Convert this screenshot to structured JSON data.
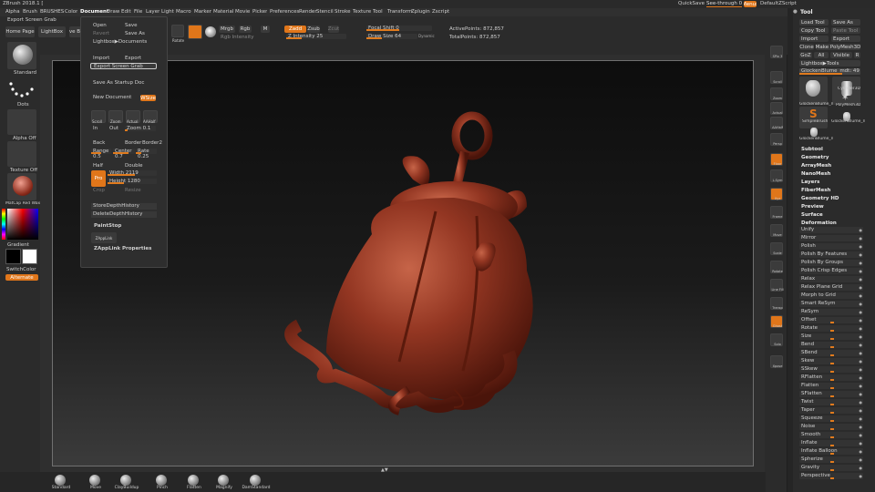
{
  "app": {
    "title": "ZBrush 2018.1 [",
    "quicksave": "QuickSave",
    "seethrough": "See-through 0",
    "menus_btn": "Menus",
    "default_script": "DefaultZScript"
  },
  "menubar": [
    "Alpha",
    "Brush",
    "BRUSHES",
    "Color",
    "Document",
    "Draw",
    "Edit",
    "File",
    "Layer",
    "Light",
    "Macro",
    "Marker",
    "Material",
    "Movie",
    "Picker",
    "Preferences",
    "Render",
    "Stencil",
    "Stroke",
    "Texture",
    "Tool",
    "Transform",
    "Zplugin",
    "Zscript"
  ],
  "toolbar": {
    "export_hint": "Export Screen Grab",
    "home_page": "Home Page",
    "lightbox": "LightBox",
    "live_boolean": "Live Boo",
    "rotate": "Rotate",
    "mrgb": "Mrgb",
    "rgb": "Rgb",
    "m": "M",
    "zadd": "Zadd",
    "zsub": "Zsub",
    "zcut": "Zcut",
    "rgb_intensity": "Rgb Intensity",
    "z_intensity": "Z Intensity 25",
    "focal_shift": "Focal Shift 0",
    "draw_size": "Draw Size 64",
    "dynamic": "Dynamic",
    "active_points": "ActivePoints: 872,857",
    "total_points": "TotalPoints: 872,857"
  },
  "document_menu": {
    "open": "Open",
    "save": "Save",
    "revert": "Revert",
    "save_as": "Save As",
    "lightbox_documents": "Lightbox▶Documents",
    "import": "Import",
    "export": "Export",
    "export_screen_grab": "Export Screen Grab",
    "save_as_startup": "Save As Startup Doc",
    "new_document": "New Document",
    "wsize": "WSize",
    "scroll": "Scroll",
    "zoom": "Zoom",
    "actual": "Actual",
    "aahalf": "AAHalf",
    "in": "In",
    "out": "Out",
    "zoom_val": "Zoom 0.1",
    "back": "Back",
    "border": "Border",
    "border2": "Border2",
    "range": "Range 0.5",
    "center": "Center 0.7",
    "rate": "Rate 0.25",
    "half": "Half",
    "double": "Double",
    "pro": "Pro",
    "width": "Width 2119",
    "height": "Height 1280",
    "crop": "Crop",
    "resize": "Resize",
    "store_depth": "StoreDepthHistory",
    "delete_depth": "DeleteDepthHistory",
    "paintstop": "PaintStop",
    "zapplink": "ZAppLink",
    "zapplink_props": "ZAppLink Properties"
  },
  "left_shelf": {
    "brush": "Standard",
    "stroke": "Dots",
    "alpha": "Alpha Off",
    "texture": "Texture Off",
    "material": "MatCap Red Wax",
    "gradient": "Gradient",
    "switch_color": "SwitchColor",
    "alternate": "Alternate"
  },
  "right_shelf": [
    "SPix 3",
    "Scroll",
    "Zoom",
    "Actual",
    "AAHalf",
    "Persp",
    "Floor",
    "L.Sym",
    "Xyz",
    "Frame",
    "Move",
    "Scale",
    "Rotate",
    "Line Fill",
    "Transp",
    "Ghost",
    "Solo",
    "Xpose"
  ],
  "tool_panel": {
    "title": "Tool",
    "load_tool": "Load Tool",
    "save_as": "Save As",
    "copy_tool": "Copy Tool",
    "paste_tool": "Paste Tool",
    "import": "Import",
    "export": "Export",
    "clone": "Clone",
    "make_polymesh": "Make PolyMesh3D",
    "goz": "GoZ",
    "all": "All",
    "visible": "Visible",
    "r": "R",
    "lightbox_tools": "Lightbox▶Tools",
    "current_tool": "GlockenBlume_mdt: 49",
    "thumbs": [
      "GlockenBlume_n",
      "Cylinder3D",
      "SimpleBrush",
      "PolyMesh3D",
      "GlockenBlume_n",
      "GlockenBlume_n"
    ],
    "sections": [
      "Subtool",
      "Geometry",
      "ArrayMesh",
      "NanoMesh",
      "Layers",
      "FiberMesh",
      "Geometry HD",
      "Preview",
      "Surface",
      "Deformation"
    ],
    "deform_items": [
      {
        "label": "Unify",
        "fill": 0
      },
      {
        "label": "Mirror",
        "fill": 0
      },
      {
        "label": "Polish",
        "fill": 0.0
      },
      {
        "label": "Polish By Features",
        "fill": 0.0
      },
      {
        "label": "Polish By Groups",
        "fill": 0.0
      },
      {
        "label": "Polish Crisp Edges",
        "fill": 0.0
      },
      {
        "label": "Relax",
        "fill": 0.0
      },
      {
        "label": "Relax Plane Grid",
        "fill": 0.0
      },
      {
        "label": "Morph to Grid",
        "fill": 0.0
      },
      {
        "label": "Smart ReSym",
        "fill": 0
      },
      {
        "label": "ReSym",
        "fill": 0
      },
      {
        "label": "Offset",
        "fill": 0.5
      },
      {
        "label": "Rotate",
        "fill": 0.5
      },
      {
        "label": "Size",
        "fill": 0.5
      },
      {
        "label": "Bend",
        "fill": 0.5
      },
      {
        "label": "SBend",
        "fill": 0.5
      },
      {
        "label": "Skew",
        "fill": 0.5
      },
      {
        "label": "SSkew",
        "fill": 0.5
      },
      {
        "label": "RFlatten",
        "fill": 0.5
      },
      {
        "label": "Flatten",
        "fill": 0.5
      },
      {
        "label": "SFlatten",
        "fill": 0.5
      },
      {
        "label": "Twist",
        "fill": 0.5
      },
      {
        "label": "Taper",
        "fill": 0.5
      },
      {
        "label": "Squeeze",
        "fill": 0.5
      },
      {
        "label": "Noise",
        "fill": 0.5
      },
      {
        "label": "Smooth",
        "fill": 0.5
      },
      {
        "label": "Inflate",
        "fill": 0.5
      },
      {
        "label": "Inflate Balloon",
        "fill": 0.5
      },
      {
        "label": "Spherize",
        "fill": 0.5
      },
      {
        "label": "Gravity",
        "fill": 0.5
      },
      {
        "label": "Perspective",
        "fill": 0.5
      }
    ]
  },
  "bottom_brushes": [
    "Standard",
    "Move",
    "ClayBuildup",
    "Pinch",
    "Flatten",
    "Magnify",
    "DamStandard"
  ],
  "colors": {
    "accent": "#e0761a",
    "panel": "#2b2b2b",
    "model": "#8a3520"
  }
}
